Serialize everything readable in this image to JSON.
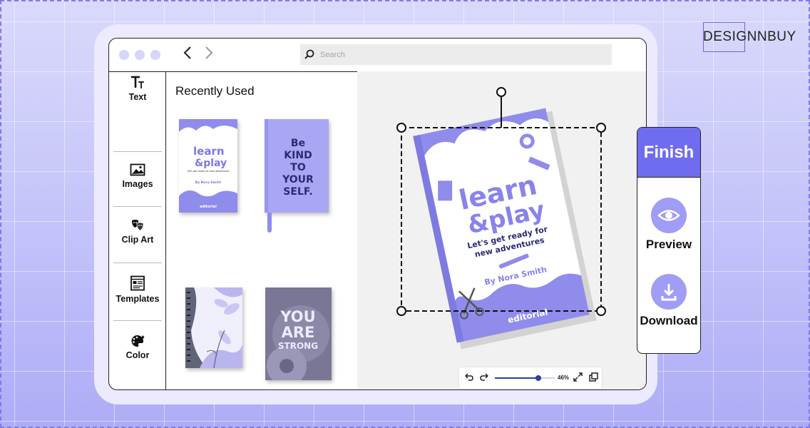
{
  "brand": {
    "name": "DESIGNNBUY"
  },
  "browser": {
    "back_icon": "chevron-left-icon",
    "forward_icon": "chevron-right-icon",
    "search": {
      "placeholder": "Search",
      "value": ""
    }
  },
  "tools": [
    {
      "label": "Text",
      "icon": "text-icon"
    },
    {
      "label": "Images",
      "icon": "image-icon"
    },
    {
      "label": "Clip Art",
      "icon": "clipart-icon"
    },
    {
      "label": "Templates",
      "icon": "templates-icon"
    },
    {
      "label": "Color",
      "icon": "palette-icon"
    }
  ],
  "recent": {
    "title": "Recently Used",
    "items": [
      {
        "name": "learn-play-notebook",
        "title_lines": [
          "learn",
          "&play"
        ],
        "subtitle": "let's get ready for new adventures",
        "author": "By Nora Smith",
        "brand": "editorial"
      },
      {
        "name": "be-kind-notebook",
        "text": "Be KIND TO YOUR SELF."
      },
      {
        "name": "floral-spiral-notebook"
      },
      {
        "name": "you-are-strong-notebook",
        "text": "YOU ARE STRONG"
      }
    ]
  },
  "canvas_book": {
    "title_lines": [
      "learn",
      "&play"
    ],
    "subtitle_lines": [
      "Let's get ready for",
      "new adventures"
    ],
    "author": "By Nora Smith",
    "brand": "editorial"
  },
  "zoom": {
    "level": "46%",
    "fraction": 0.46,
    "undo_icon": "undo-icon",
    "redo_icon": "redo-icon",
    "fit_icon": "expand-icon",
    "layers_icon": "layers-icon"
  },
  "finish": {
    "label": "Finish",
    "preview_label": "Preview",
    "download_label": "Download"
  },
  "colors": {
    "accent": "#6f6cf0",
    "light_accent": "#9f9df6",
    "book": "#8f8cec"
  }
}
